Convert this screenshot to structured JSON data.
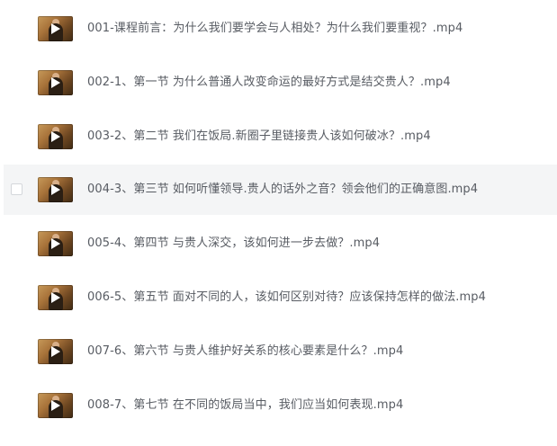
{
  "file_list": {
    "items": [
      {
        "name": "001-课程前言：为什么我们要学会与人相处？为什么我们要重视？.mp4",
        "icon": "video-thumbnail-icon"
      },
      {
        "name": "002-1、第一节 为什么普通人改变命运的最好方式是结交贵人？.mp4",
        "icon": "video-thumbnail-icon"
      },
      {
        "name": "003-2、第二节 我们在饭局.新圈子里链接贵人该如何破冰？.mp4",
        "icon": "video-thumbnail-icon"
      },
      {
        "name": "004-3、第三节 如何听懂领导.贵人的话外之音？领会他们的正确意图.mp4",
        "icon": "video-thumbnail-icon"
      },
      {
        "name": "005-4、第四节 与贵人深交，该如何进一步去做？.mp4",
        "icon": "video-thumbnail-icon"
      },
      {
        "name": "006-5、第五节 面对不同的人，该如何区别对待？应该保持怎样的做法.mp4",
        "icon": "video-thumbnail-icon"
      },
      {
        "name": "007-6、第六节 与贵人维护好关系的核心要素是什么？.mp4",
        "icon": "video-thumbnail-icon"
      },
      {
        "name": "008-7、第七节 在不同的饭局当中，我们应当如何表现.mp4",
        "icon": "video-thumbnail-icon"
      }
    ],
    "hovered_index": 3,
    "colors": {
      "text": "#585c63",
      "hover_background": "#f4f5f6",
      "checkbox_border": "#d4d7db"
    }
  }
}
